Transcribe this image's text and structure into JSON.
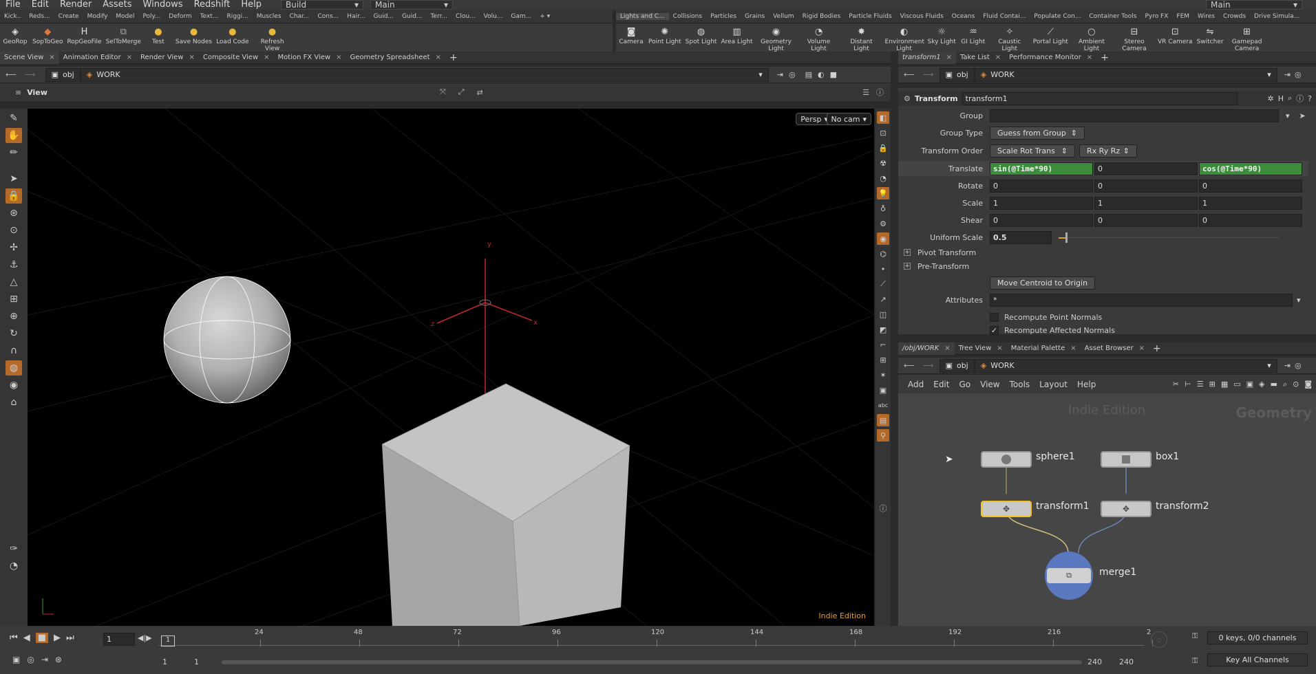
{
  "menubar": {
    "items": [
      "File",
      "Edit",
      "Render",
      "Assets",
      "Windows",
      "Redshift",
      "Help"
    ],
    "desktop_dropdown": "Build",
    "context_dropdown": "Main",
    "right_dropdown": "Main"
  },
  "shelf_left": {
    "tabs": [
      "Kick..",
      "Reds...",
      "Create",
      "Modify",
      "Model",
      "Poly...",
      "Deform",
      "Text...",
      "Riggi...",
      "Muscles",
      "Char...",
      "Cons...",
      "Hair...",
      "Guid...",
      "Guid...",
      "Terr...",
      "Clou...",
      "Volu...",
      "Gam..."
    ],
    "tools": [
      {
        "label": "GeoRop",
        "icon": "georop-icon"
      },
      {
        "label": "SopToGeo",
        "icon": "soptogeo-icon"
      },
      {
        "label": "RopGeoFile",
        "icon": "ropgeofile-icon"
      },
      {
        "label": "SelToMerge",
        "icon": "seltomerge-icon"
      },
      {
        "label": "Test",
        "icon": "python-icon"
      },
      {
        "label": "Save Nodes",
        "icon": "python-icon"
      },
      {
        "label": "Load Code",
        "icon": "python-icon"
      },
      {
        "label": "Refresh View",
        "icon": "python-icon"
      }
    ]
  },
  "shelf_right": {
    "tabs": [
      "Lights and C...",
      "Collisions",
      "Particles",
      "Grains",
      "Vellum",
      "Rigid Bodies",
      "Particle Fluids",
      "Viscous Fluids",
      "Oceans",
      "Fluid Contai...",
      "Populate Con...",
      "Container Tools",
      "Pyro FX",
      "FEM",
      "Wires",
      "Crowds",
      "Drive Simula..."
    ],
    "tools": [
      {
        "label": "Camera",
        "icon": "camera-icon"
      },
      {
        "label": "Point Light",
        "icon": "point-light-icon"
      },
      {
        "label": "Spot Light",
        "icon": "spot-light-icon"
      },
      {
        "label": "Area Light",
        "icon": "area-light-icon"
      },
      {
        "label": "Geometry Light",
        "icon": "geometry-light-icon"
      },
      {
        "label": "Volume Light",
        "icon": "volume-light-icon"
      },
      {
        "label": "Distant Light",
        "icon": "distant-light-icon"
      },
      {
        "label": "Environment Light",
        "icon": "environment-light-icon"
      },
      {
        "label": "Sky Light",
        "icon": "sky-light-icon"
      },
      {
        "label": "GI Light",
        "icon": "gi-light-icon"
      },
      {
        "label": "Caustic Light",
        "icon": "caustic-light-icon"
      },
      {
        "label": "Portal Light",
        "icon": "portal-light-icon"
      },
      {
        "label": "Ambient Light",
        "icon": "ambient-light-icon"
      },
      {
        "label": "Stereo Camera",
        "icon": "stereo-camera-icon"
      },
      {
        "label": "VR Camera",
        "icon": "vr-camera-icon"
      },
      {
        "label": "Switcher",
        "icon": "switcher-icon"
      },
      {
        "label": "Gamepad Camera",
        "icon": "gamepad-camera-icon"
      }
    ]
  },
  "left_pane": {
    "tabs": [
      "Scene View",
      "Animation Editor",
      "Render View",
      "Composite View",
      "Motion FX View",
      "Geometry Spreadsheet"
    ],
    "path": {
      "root": "obj",
      "node": "WORK"
    },
    "view_label": "View",
    "persp_button": "Persp",
    "cam_button": "No cam",
    "watermark": "Indie Edition",
    "axis_labels": {
      "x": "x",
      "y": "y",
      "z": "z"
    }
  },
  "param_pane": {
    "tabs": [
      "transform1",
      "Take List",
      "Performance Monitor"
    ],
    "path": {
      "root": "obj",
      "node": "WORK"
    },
    "node_type": "Transform",
    "node_name": "transform1",
    "group": {
      "label": "Group",
      "value": ""
    },
    "group_type": {
      "label": "Group Type",
      "value": "Guess from Group"
    },
    "transform_order": {
      "label": "Transform Order",
      "value": "Scale Rot Trans",
      "rot_order": "Rx Ry Rz"
    },
    "translate": {
      "label": "Translate",
      "x": "sin(@Time*90)",
      "y": "0",
      "z": "cos(@Time*90)"
    },
    "rotate": {
      "label": "Rotate",
      "x": "0",
      "y": "0",
      "z": "0"
    },
    "scale": {
      "label": "Scale",
      "x": "1",
      "y": "1",
      "z": "1"
    },
    "shear": {
      "label": "Shear",
      "x": "0",
      "y": "0",
      "z": "0"
    },
    "uniform_scale": {
      "label": "Uniform Scale",
      "value": "0.5"
    },
    "pivot_transform": "Pivot Transform",
    "pre_transform": "Pre-Transform",
    "move_centroid": "Move Centroid to Origin",
    "attributes": {
      "label": "Attributes",
      "value": "*"
    },
    "recompute_point_normals": {
      "label": "Recompute Point Normals",
      "checked": false
    },
    "recompute_affected_normals": {
      "label": "Recompute Affected Normals",
      "checked": true
    }
  },
  "net_pane": {
    "tabs": [
      "/obj/WORK",
      "Tree View",
      "Material Palette",
      "Asset Browser"
    ],
    "path": {
      "root": "obj",
      "node": "WORK"
    },
    "menu": [
      "Add",
      "Edit",
      "Go",
      "View",
      "Tools",
      "Layout",
      "Help"
    ],
    "watermark": "Indie Edition",
    "context_label": "Geometry",
    "nodes": [
      {
        "name": "sphere1",
        "icon": "sphere-icon"
      },
      {
        "name": "box1",
        "icon": "box-icon"
      },
      {
        "name": "transform1",
        "icon": "transform-icon"
      },
      {
        "name": "transform2",
        "icon": "transform-icon"
      },
      {
        "name": "merge1",
        "icon": "merge-icon"
      }
    ]
  },
  "timeline": {
    "current_frame": "1",
    "frame_marker": "1",
    "ticks": [
      "24",
      "48",
      "72",
      "96",
      "120",
      "144",
      "168",
      "192",
      "216",
      "2"
    ],
    "range_start": "1",
    "range_start2": "1",
    "range_end": "240",
    "range_end2": "240",
    "keys_status": "0 keys, 0/0 channels",
    "key_all_channels": "Key All Channels"
  }
}
